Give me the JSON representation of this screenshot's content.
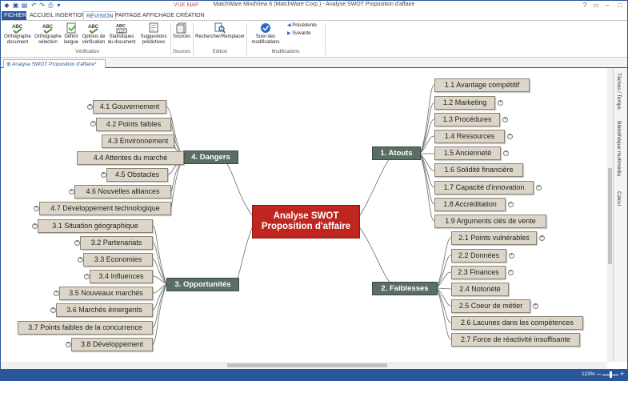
{
  "window": {
    "title": "MatchWare MindView 6 (MatchWare Corp.) - Analyse SWOT Proposition d'affaire",
    "context_tab": "VUE MAP"
  },
  "tabs": [
    "FICHIER",
    "ACCUEIL",
    "INSERTION",
    "RÉVISION",
    "PARTAGE",
    "AFFICHAGE",
    "CRÉATION"
  ],
  "ribbon": {
    "buttons": {
      "ortho_doc": "Orthographe document",
      "ortho_sel": "Orthographe sélection",
      "langue": "Définir langue",
      "options": "Options de vérification",
      "stats": "Statistiques du document",
      "suggestions": "Suggestions prédictives",
      "sources": "Sources",
      "rechercher": "Rechercher/Remplacer",
      "suivi": "Suivi des modifications",
      "precedente": "Précédente",
      "suivante": "Suivante"
    },
    "groups": {
      "verification": "Vérification",
      "sources": "Sources",
      "edition": "Edition",
      "modifications": "Modifications"
    }
  },
  "document_tab": "Analyse SWOT Proposition d'affaire*",
  "map": {
    "central_line1": "Analyse SWOT",
    "central_line2": "Proposition d'affaire",
    "branches": {
      "atouts": "1.  Atouts",
      "faiblesses": "2.  Faiblesses",
      "opportunites": "3.  Opportunités",
      "dangers": "4.  Dangers"
    },
    "atouts": [
      "1.1  Avantage compétitif",
      "1.2  Marketing",
      "1.3  Procédures",
      "1.4  Ressources",
      "1.5  Ancienneté",
      "1.6  Solidité financière",
      "1.7  Capacité d'innovation",
      "1.8  Accréditation",
      "1.9  Arguments clés de vente"
    ],
    "faiblesses": [
      "2.1  Points vulnérables",
      "2.2  Données",
      "2.3  Finances",
      "2.4  Notoriété",
      "2.5  Coeur de métier",
      "2.6  Lacunes dans les compétences",
      "2.7  Force de réactivité insuffisante"
    ],
    "opportunites": [
      "3.1  Situation géographique",
      "3.2  Partenariats",
      "3.3  Economies",
      "3.4  Influences",
      "3.5  Nouveaux marchés",
      "3.6  Marchés émergents",
      "3.7  Points faibles de la concurrence",
      "3.8  Développement"
    ],
    "dangers": [
      "4.1  Gouvernement",
      "4.2  Points faibles",
      "4.3  Environnement",
      "4.4  Attentes du marché",
      "4.5  Obstacles",
      "4.6  Nouvelles alliances",
      "4.7  Développement technologique"
    ]
  },
  "side_panels": [
    "Tâches / Temps",
    "Bibliothèque multimédia",
    "Calcul"
  ],
  "status": {
    "zoom": "123%"
  }
}
